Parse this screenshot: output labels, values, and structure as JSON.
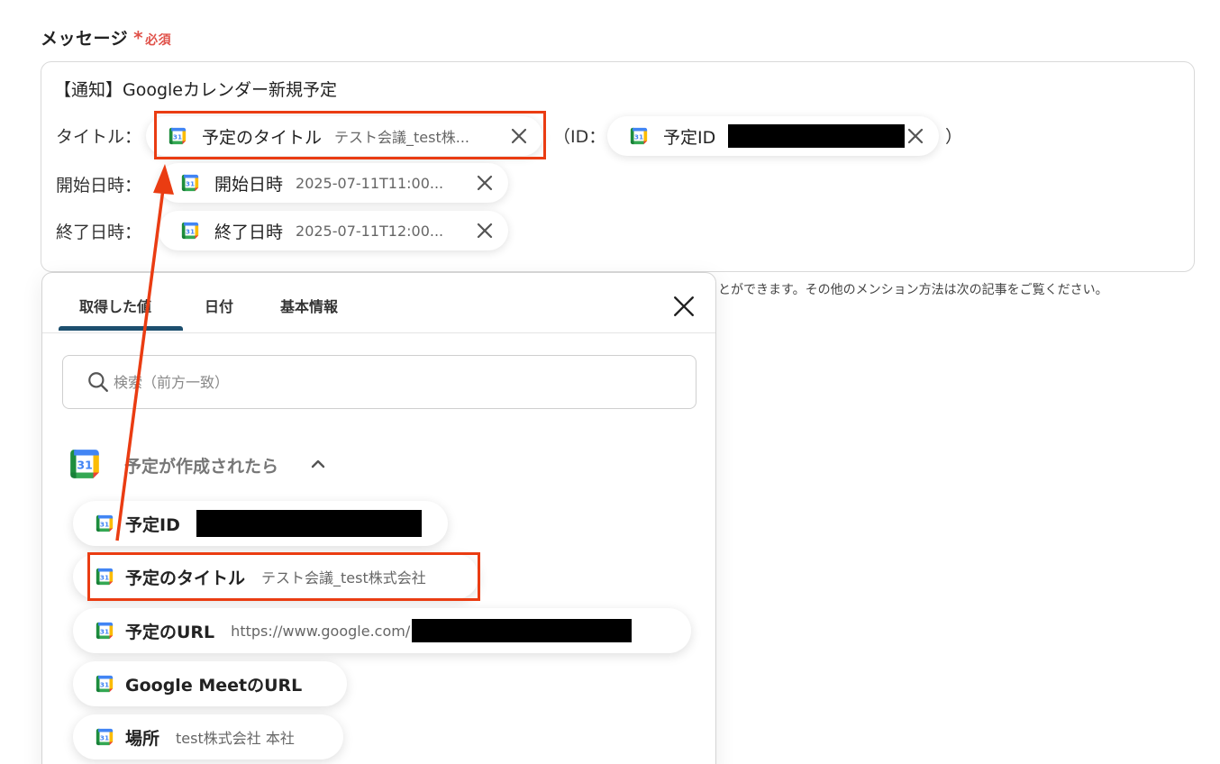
{
  "field": {
    "label": "メッセージ",
    "required_star": "*",
    "required_text": "必須"
  },
  "message": {
    "first_line": "【通知】Googleカレンダー新規予定",
    "rows": [
      {
        "label": "タイトル：",
        "chip_title": "予定のタイトル",
        "chip_value": "テスト会議_test株..."
      },
      {
        "label": "開始日時：",
        "chip_title": "開始日時",
        "chip_value": "2025-07-11T11:00..."
      },
      {
        "label": "終了日時：",
        "chip_title": "終了日時",
        "chip_value": "2025-07-11T12:00..."
      }
    ],
    "id_open": "（ID：",
    "id_chip_title": "予定ID",
    "id_close": "）"
  },
  "hint": "とができます。その他のメンション方法は次の記事をご覧ください。",
  "panel": {
    "tabs": [
      {
        "label": "取得した値",
        "active": true
      },
      {
        "label": "日付",
        "active": false
      },
      {
        "label": "基本情報",
        "active": false
      }
    ],
    "search_placeholder": "検索（前方一致）",
    "group_title": "予定が作成されたら",
    "items": [
      {
        "title": "予定ID",
        "value": ""
      },
      {
        "title": "予定のタイトル",
        "value": "テスト会議_test株式会社"
      },
      {
        "title": "予定のURL",
        "value": "https://www.google.com/"
      },
      {
        "title": "Google MeetのURL",
        "value": ""
      },
      {
        "title": "場所",
        "value": "test株式会社 本社"
      }
    ]
  },
  "icons": {
    "calendar": "google-calendar-icon",
    "remove": "close-icon",
    "search": "search-icon",
    "collapse": "chevron-up-icon"
  },
  "colors": {
    "highlight": "#ea3c12",
    "required": "#e0524a",
    "tab_active_underline": "#1d4f6e"
  }
}
